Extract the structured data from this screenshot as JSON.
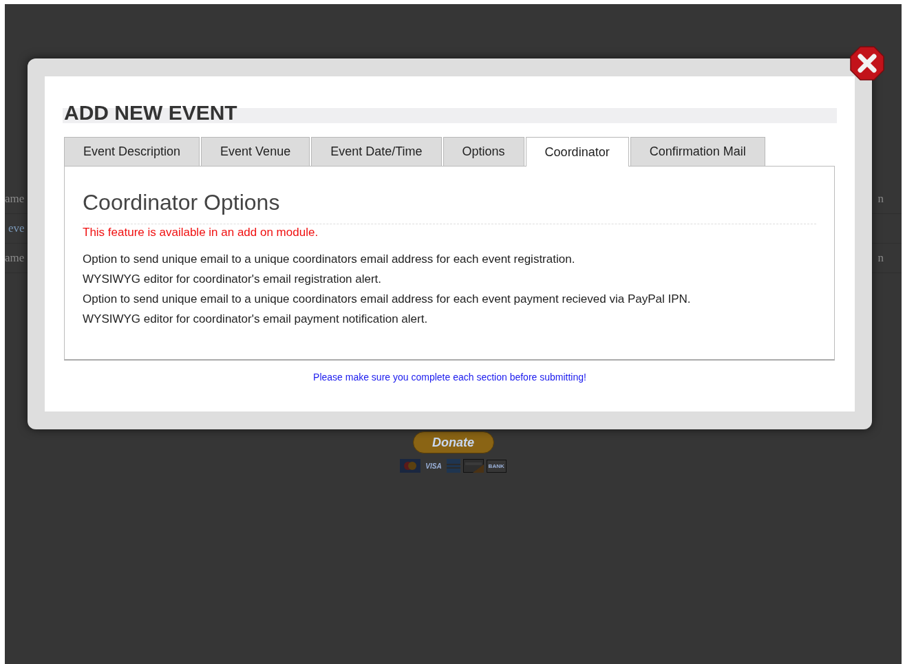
{
  "background_page": {
    "rows": [
      {
        "left": "ame",
        "right": "n"
      },
      {
        "left": "eve",
        "right": ""
      },
      {
        "left": "ame",
        "right": "n"
      }
    ],
    "donate_button": {
      "label": "Donate"
    },
    "card_logos": [
      {
        "kind": "circles"
      },
      {
        "kind": "text",
        "label": "VISA"
      },
      {
        "kind": "stripes"
      },
      {
        "kind": "plain"
      },
      {
        "kind": "text",
        "label": "BANK"
      }
    ]
  },
  "modal": {
    "title": "ADD NEW EVENT",
    "tabs": [
      {
        "label": "Event Description",
        "selected": false
      },
      {
        "label": "Event Venue",
        "selected": false
      },
      {
        "label": "Event Date/Time",
        "selected": false
      },
      {
        "label": "Options",
        "selected": false
      },
      {
        "label": "Coordinator",
        "selected": true
      },
      {
        "label": "Confirmation Mail",
        "selected": false
      }
    ],
    "panel": {
      "heading": "Coordinator Options",
      "notice": "This feature is available in an add on module.",
      "lines": [
        "Option to send unique email to a unique coordinators email address for each event registration.",
        "WYSIWYG editor for coordinator's email registration alert.",
        "Option to send unique email to a unique coordinators email address for each event payment recieved via PayPal IPN.",
        "WYSIWYG editor for coordinator's email payment notification alert."
      ]
    },
    "footer_note": "Please make sure you complete each section before submitting!"
  }
}
